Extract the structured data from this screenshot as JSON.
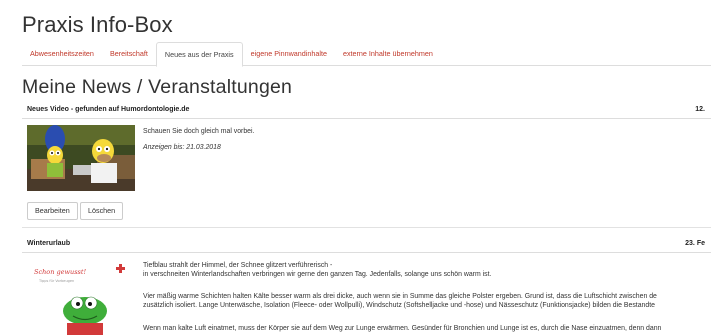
{
  "app": {
    "title": "Praxis Info-Box"
  },
  "tabs": [
    {
      "label": "Abwesenheitszeiten",
      "active": false
    },
    {
      "label": "Bereitschaft",
      "active": false
    },
    {
      "label": "Neues aus der Praxis",
      "active": true
    },
    {
      "label": "eigene Pinnwandinhalte",
      "active": false
    },
    {
      "label": "externe Inhalte übernehmen",
      "active": false
    }
  ],
  "main": {
    "section_title": "Meine News / Veranstaltungen",
    "news": [
      {
        "title": "Neues Video - gefunden auf Humordontologie.de",
        "date": "12.",
        "body": "Schauen Sie doch gleich mal vorbei.",
        "display_until": "Anzeigen bis: 21.03.2018",
        "actions": {
          "edit": "Bearbeiten",
          "delete": "Löschen"
        }
      },
      {
        "title": "Winterurlaub",
        "date": "23. Fe",
        "image_caption_top": "Schon gewusst!",
        "image_caption_sub": "Tipps für Vorbeugen",
        "lines": [
          "Tiefblau strahlt der Himmel, der Schnee glitzert verführerisch -",
          "in verschneiten Winterlandschaften verbringen wir gerne den ganzen Tag. Jedenfalls, solange uns schön warm ist.",
          "Vier mäßig warme Schichten halten Kälte besser warm als drei dicke, auch wenn sie in Summe das gleiche Polster ergeben. Grund ist, dass die Luftschicht zwischen de",
          "zusätzlich isoliert. Lange Unterwäsche, Isolation (Fleece- oder Wollpulli), Windschutz (Softshelljacke und -hose) und Nässeschutz (Funktionsjacke) bilden die Bestandte",
          "Wenn man kalte Luft einatmet, muss der Körper sie auf dem Weg zur Lunge erwärmen. Gesünder für Bronchien und Lunge ist es, durch die Nase einzuatmen, denn dann"
        ]
      }
    ]
  },
  "colors": {
    "tab_link": "#c0392b",
    "border": "#dddddd",
    "text": "#333333"
  }
}
